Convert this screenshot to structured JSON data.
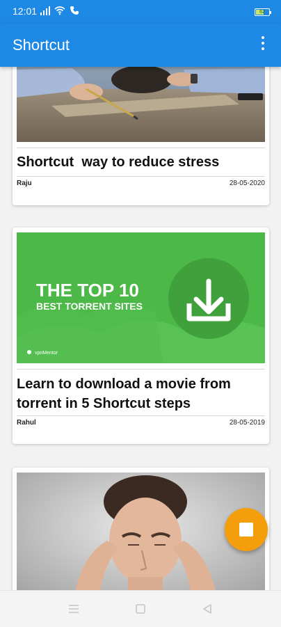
{
  "status_bar": {
    "time": "12:01",
    "battery": "62",
    "battery_level": 0.62
  },
  "app_bar": {
    "title": "Shortcut",
    "menu_icon": "overflow-menu-icon"
  },
  "feed": {
    "cards": [
      {
        "image": "person-head-down-on-desk-photo",
        "title": "Shortcut  way to reduce stress",
        "author": "Raju",
        "date": "28-05-2020"
      },
      {
        "image": "torrent-sites-banner",
        "banner_heading": "THE TOP 10",
        "banner_subheading": "BEST TORRENT SITES",
        "banner_badge": "vpnMentor",
        "title": "Learn to download a movie from torrent in 5 Shortcut steps",
        "author": "Rahul",
        "date": "28-05-2019"
      },
      {
        "image": "man-holding-temples-headache-photo"
      }
    ]
  },
  "fab": {
    "icon": "stop-icon"
  },
  "nav_bar": {
    "icons": [
      "menu-icon",
      "home-square-icon",
      "back-triangle-icon"
    ]
  },
  "colors": {
    "primary": "#1e88e5",
    "accent": "#f59e0b",
    "banner_green": "#4cb848"
  }
}
